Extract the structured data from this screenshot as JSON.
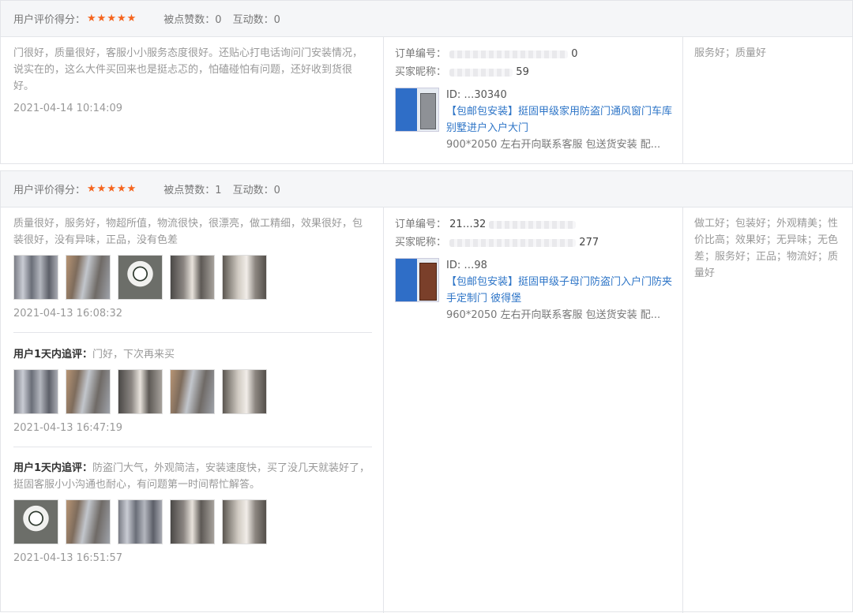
{
  "reviews": [
    {
      "header": {
        "score_label": "用户评价得分：",
        "stars": "★★★★★",
        "likes": "被点赞数：0",
        "interactions": "互动数：0"
      },
      "text": "门很好，质量很好，客服小小服务态度很好。还贴心打电话询问门安装情况，说实在的，这么大件买回来也是挺忐忑的，怕磕碰怕有问题，还好收到货很好。",
      "time": "2021-04-14 10:14:09",
      "order": {
        "order_no_label": "订单编号：",
        "order_no_visible": "0",
        "buyer_label": "买家昵称：",
        "buyer_visible": "59",
        "product_id": "ID: …30340",
        "product_title": "【包邮包安装】挺固甲级家用防盗门通风窗门车库别墅进户入户大门",
        "product_spec": "900*2050 左右开向联系客服 包送货安装 配..."
      },
      "tags": "服务好；质量好"
    },
    {
      "header": {
        "score_label": "用户评价得分：",
        "stars": "★★★★★",
        "likes": "被点赞数：1",
        "interactions": "互动数：0"
      },
      "text": "质量很好，服务好，物超所值，物流很快，很漂亮，做工精细，效果很好，包装很好，没有异味，正品，没有色差",
      "time": "2021-04-13 16:08:32",
      "followups": [
        {
          "label": "用户1天内追评：",
          "text": "门好，下次再来买",
          "time": "2021-04-13 16:47:19"
        },
        {
          "label": "用户1天内追评：",
          "text": "防盗门大气，外观简洁，安装速度快，买了没几天就装好了，挺固客服小小沟通也耐心，有问题第一时间帮忙解答。",
          "time": "2021-04-13 16:51:57"
        }
      ],
      "order": {
        "order_no_label": "订单编号：",
        "order_no_visible": "21…32",
        "buyer_label": "买家昵称：",
        "buyer_visible": "277",
        "product_id": "ID: …98",
        "product_title": "【包邮包安装】挺固甲级子母门防盗门入户门防夹手定制门 彼得堡",
        "product_spec": "960*2050 左右开向联系客服 包送货安装 配..."
      },
      "tags": "做工好；包装好；外观精美；性价比高；效果好；无异味；无色差；服务好；正品；物流好；质量好"
    }
  ]
}
